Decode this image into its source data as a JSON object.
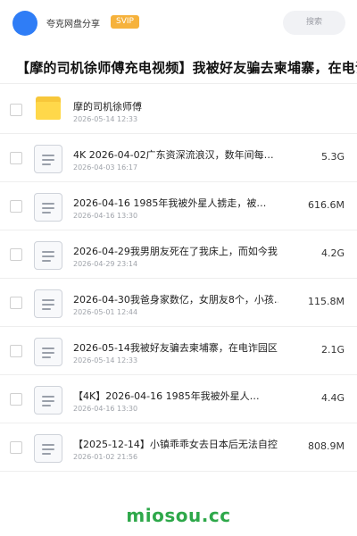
{
  "header": {
    "owner_name": "夸克网盘分享",
    "badge": "SVIP",
    "search_placeholder": "搜索"
  },
  "share_title": "【摩的司机徐师傅充电视频】我被好友骗去柬埔寨，在电诈",
  "files": [
    {
      "type": "folder",
      "name": "摩的司机徐师傅",
      "date": "2026-05-14 12:33",
      "size": ""
    },
    {
      "type": "file",
      "name": "4K 2026-04-02广东资深流浪汉，数年间每…",
      "date": "2026-04-03 16:17",
      "size": "5.3G"
    },
    {
      "type": "file",
      "name": "2026-04-16 1985年我被外星人掳走，被…",
      "date": "2026-04-16 13:30",
      "size": "616.6M"
    },
    {
      "type": "file",
      "name": "2026-04-29我男朋友死在了我床上，而如今我…",
      "date": "2026-04-29 23:14",
      "size": "4.2G"
    },
    {
      "type": "file",
      "name": "2026-04-30我爸身家数亿，女朋友8个，小孩…",
      "date": "2026-05-01 12:44",
      "size": "115.8M"
    },
    {
      "type": "file",
      "name": "2026-05-14我被好友骗去柬埔寨，在电诈园区…",
      "date": "2026-05-14 12:33",
      "size": "2.1G"
    },
    {
      "type": "file",
      "name": "【4K】2026-04-16 1985年我被外星人…",
      "date": "2026-04-16 13:30",
      "size": "4.4G"
    },
    {
      "type": "file",
      "name": "【2025-12-14】小镇乖乖女去日本后无法自控…",
      "date": "2026-01-02 21:56",
      "size": "808.9M"
    }
  ],
  "watermark": "miosou.cc",
  "colors": {
    "avatar": "#2f7df6",
    "badge_bg": "#f6b23c",
    "folder": "#ffd84a",
    "watermark": "#2ea84a"
  }
}
